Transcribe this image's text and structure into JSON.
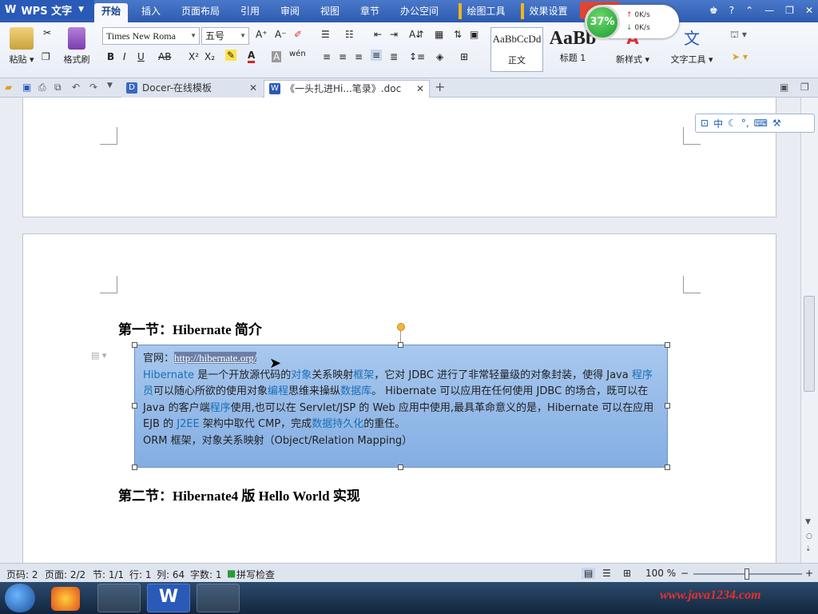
{
  "app": {
    "name": "WPS 文字"
  },
  "ribbon_tabs": [
    "开始",
    "插入",
    "页面布局",
    "引用",
    "审阅",
    "视图",
    "章节",
    "办公空间"
  ],
  "context_tabs": [
    "绘图工具",
    "效果设置"
  ],
  "network": {
    "percent": "37%",
    "up": "0K/s",
    "down": "0K/s"
  },
  "ribbon": {
    "paste": "粘贴",
    "format_painter": "格式刷",
    "font_name": "Times New Roma",
    "font_size": "五号",
    "style_normal_sample": "AaBbCcDd",
    "style_normal": "正文",
    "style_h1_sample": "AaBb",
    "style_h1": "标题 1",
    "new_style": "新样式",
    "text_tools": "文字工具"
  },
  "tabs": {
    "docer": "Docer-在线模板",
    "doc": "《一头扎进Hi...笔录》.doc"
  },
  "ime": {
    "mode": "中"
  },
  "document": {
    "heading1": "第一节：Hibernate 简介",
    "official_label": "官网：",
    "official_link": "http://hibernate.org/",
    "p1a": "Hibernate",
    "p1b": " 是一个开放源代码的",
    "p1c": "对象",
    "p1d": "关系映射",
    "p1e": "框架",
    "p1f": "，它对 JDBC 进行了非常轻量级的对象封装，使得 Java ",
    "p1g": "程序员",
    "p1h": "可以随心所欲的使用对象",
    "p1i": "编程",
    "p1j": "思维来操纵",
    "p1k": "数据库",
    "p1l": "。 Hibernate 可以应用在任何使用 JDBC 的场合，既可以在 Java 的客户端",
    "p1m": "程序",
    "p1n": "使用,也可以在 Servlet/JSP 的 Web 应用中使用,最具革命意义的是，Hibernate 可以在应用 EJB 的 ",
    "p1o": "J2EE",
    "p1p": " 架构中取代 CMP，完成",
    "p1q": "数据持久化",
    "p1r": "的重任。",
    "p2": "ORM 框架，对象关系映射（Object/Relation Mapping）",
    "heading2": "第二节：Hibernate4 版 Hello World 实现"
  },
  "status": {
    "page": "页码: 2",
    "pages": "页面: 2/2",
    "section": "节: 1/1",
    "row": "行: 1",
    "col": "列: 64",
    "words": "字数: 1",
    "spell": "拼写检查",
    "zoom": "100 %"
  },
  "watermark": "www.java1234.com"
}
